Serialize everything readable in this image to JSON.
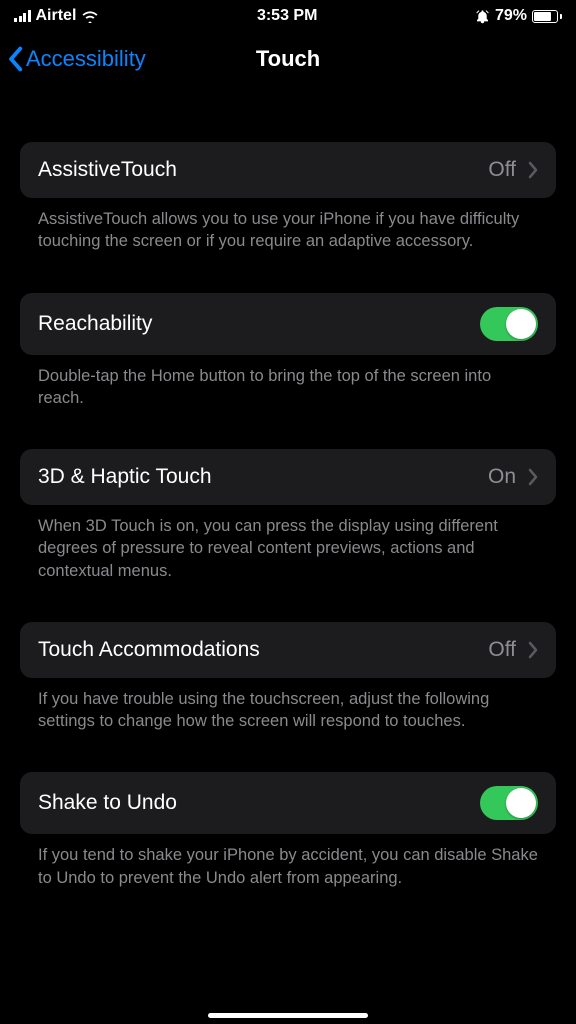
{
  "statusBar": {
    "carrier": "Airtel",
    "time": "3:53 PM",
    "batteryPercent": "79%"
  },
  "nav": {
    "backLabel": "Accessibility",
    "title": "Touch"
  },
  "items": [
    {
      "label": "AssistiveTouch",
      "value": "Off",
      "footer": "AssistiveTouch allows you to use your iPhone if you have difficulty touching the screen or if you require an adaptive accessory."
    },
    {
      "label": "Reachability",
      "toggleOn": true,
      "footer": "Double-tap the Home button to bring the top of the screen into reach."
    },
    {
      "label": "3D & Haptic Touch",
      "value": "On",
      "footer": "When 3D Touch is on, you can press the display using different degrees of pressure to reveal content previews, actions and contextual menus."
    },
    {
      "label": "Touch Accommodations",
      "value": "Off",
      "footer": "If you have trouble using the touchscreen, adjust the following settings to change how the screen will respond to touches."
    },
    {
      "label": "Shake to Undo",
      "toggleOn": true,
      "footer": "If you tend to shake your iPhone by accident, you can disable Shake to Undo to prevent the Undo alert from appearing."
    }
  ]
}
